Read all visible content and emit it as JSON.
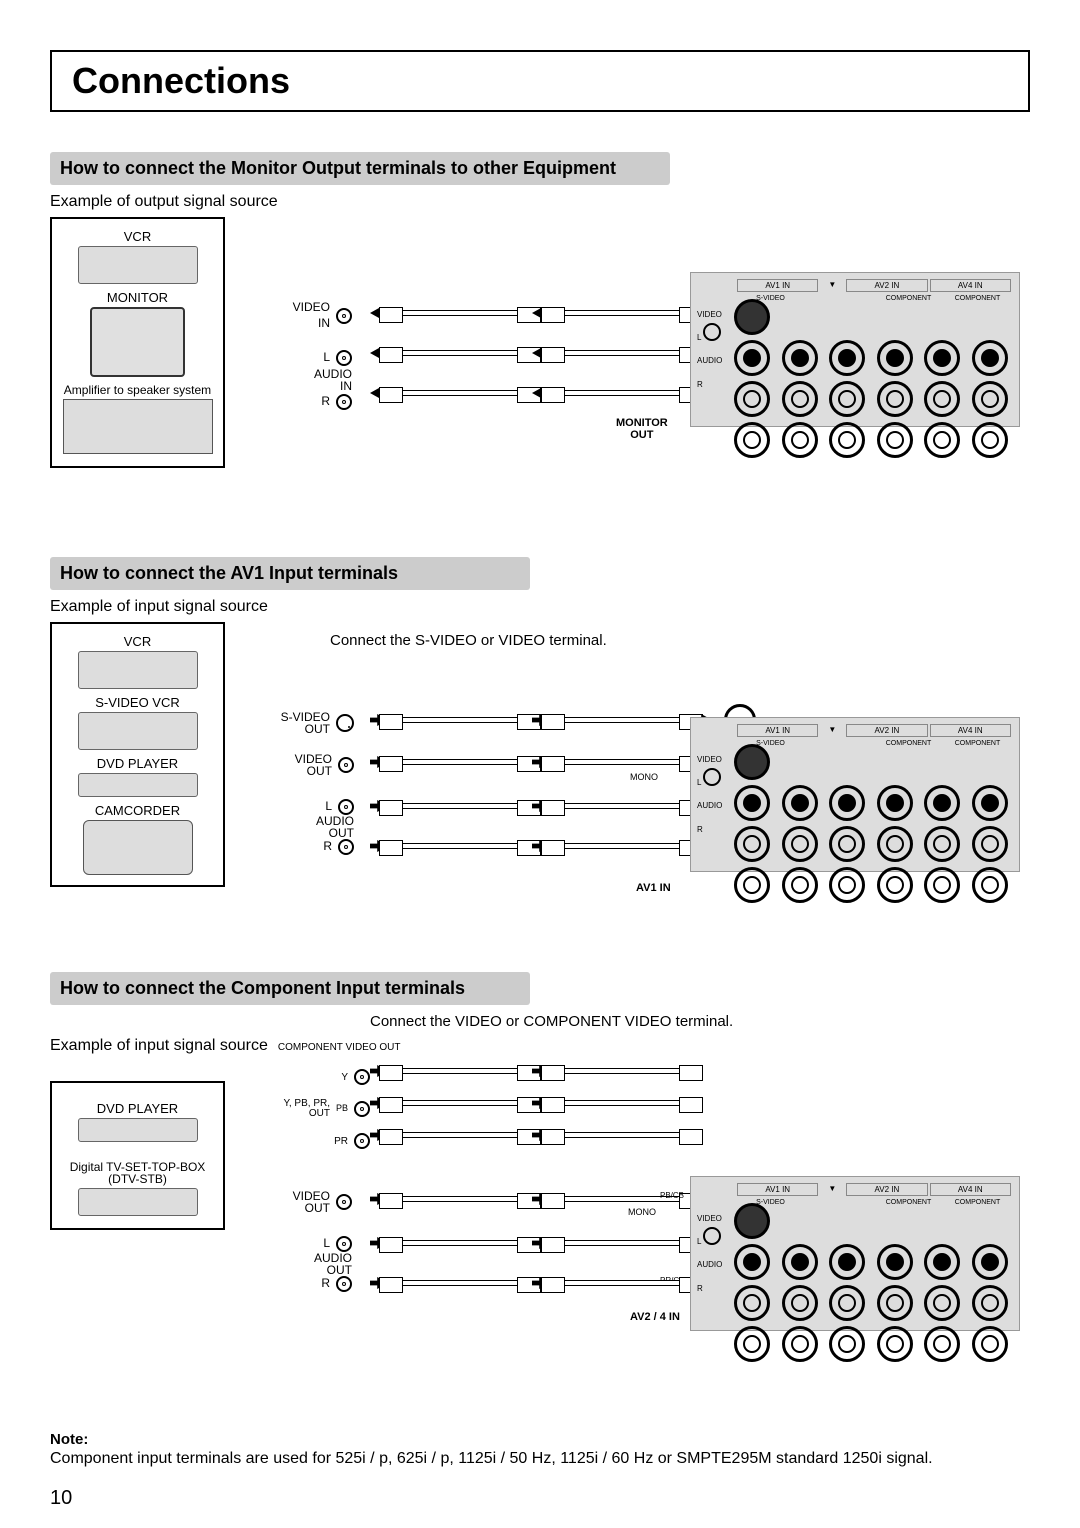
{
  "page": {
    "title": "Connections",
    "number": "10"
  },
  "section1": {
    "heading": "How to connect the Monitor Output terminals to other Equipment",
    "caption": "Example of output signal source",
    "devices": {
      "vcr": "VCR",
      "monitor": "MONITOR",
      "amp": "Amplifier to speaker system"
    },
    "io": {
      "video": "VIDEO",
      "in": "IN",
      "l": "L",
      "audio": "AUDIO",
      "r": "R"
    },
    "panel_label": "MONITOR\nOUT"
  },
  "section2": {
    "heading": "How to connect the AV1 Input terminals",
    "caption": "Example of input signal source",
    "tip": "Connect the S-VIDEO or VIDEO terminal.",
    "devices": {
      "vcr": "VCR",
      "svcr": "S-VIDEO VCR",
      "dvd": "DVD PLAYER",
      "cam": "CAMCORDER"
    },
    "io": {
      "svideo": "S-VIDEO",
      "out": "OUT",
      "video": "VIDEO",
      "l": "L",
      "audio": "AUDIO",
      "r": "R",
      "mono": "MONO"
    },
    "panel_label": "AV1 IN"
  },
  "section3": {
    "heading": "How to connect the Component Input terminals",
    "caption": "Example of input signal source",
    "tip": "Connect the VIDEO or COMPONENT VIDEO terminal.",
    "component_label": "COMPONENT VIDEO OUT",
    "component_sig": "Y,  PB, PR,",
    "out": "OUT",
    "y": "Y",
    "pb": "PB",
    "pr": "PR",
    "devices": {
      "dvd": "DVD PLAYER",
      "stb1": "Digital TV-SET-TOP-BOX",
      "stb2": "(DTV-STB)"
    },
    "io": {
      "video": "VIDEO",
      "l": "L",
      "audio": "AUDIO",
      "r": "R",
      "mono": "MONO",
      "pbcb": "PB/CB",
      "prcr": "PR/CR"
    },
    "panel_label": "AV2 / 4 IN"
  },
  "panel_headers": {
    "av1": "AV1  IN",
    "down": "▼",
    "av2": "AV2  IN",
    "av4": "AV4  IN",
    "component": "COMPONENT",
    "monitor_out": "MONITOR  OUT",
    "svideo": "S-VIDEO",
    "video": "VIDEO",
    "mono": "MONO",
    "l": "L",
    "audio": "AUDIO",
    "r": "R",
    "pb": "PB",
    "pr": "PR"
  },
  "note": {
    "heading": "Note:",
    "body": "Component input terminals are used for 525i / p, 625i / p, 1125i / 50 Hz, 1125i / 60 Hz or SMPTE295M standard 1250i signal."
  }
}
